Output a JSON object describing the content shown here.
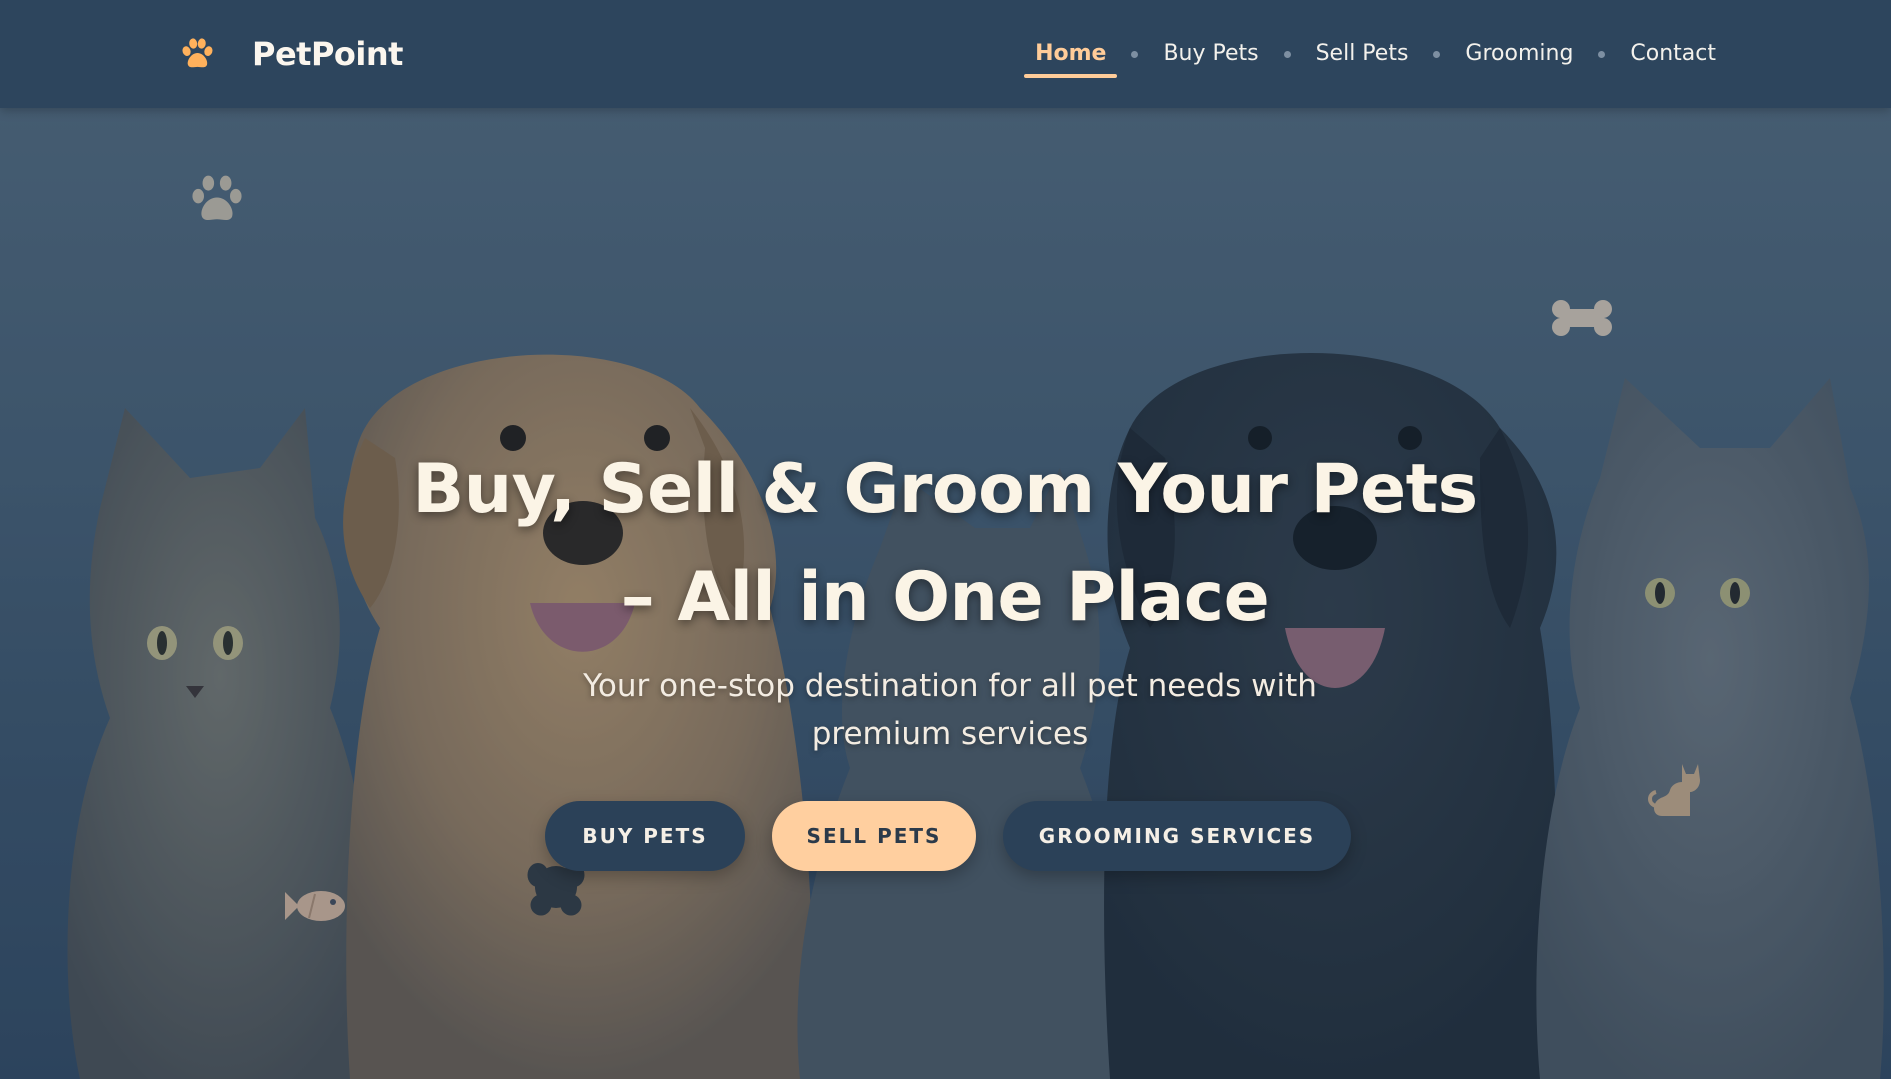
{
  "brand": {
    "name": "PetPoint",
    "icon": "paw-icon",
    "accent_color": "#ffcc99"
  },
  "nav": {
    "items": [
      {
        "label": "Home",
        "active": true
      },
      {
        "label": "Buy Pets",
        "active": false
      },
      {
        "label": "Sell Pets",
        "active": false
      },
      {
        "label": "Grooming",
        "active": false
      },
      {
        "label": "Contact",
        "active": false
      }
    ],
    "background_color": "#2d455d"
  },
  "hero": {
    "title_line1": "Buy, Sell & Groom Your Pets",
    "title_line2": "– All in One Place",
    "subtitle_line1": "Your one-stop destination for all pet needs with",
    "subtitle_line2": "premium services",
    "decorations": [
      "paw-icon",
      "bone-icon",
      "cat-icon",
      "fish-icon",
      "paw-icon"
    ],
    "buttons": [
      {
        "label": "Buy Pets",
        "style": "dark"
      },
      {
        "label": "Sell Pets",
        "style": "light"
      },
      {
        "label": "Grooming Services",
        "style": "dark"
      }
    ]
  }
}
